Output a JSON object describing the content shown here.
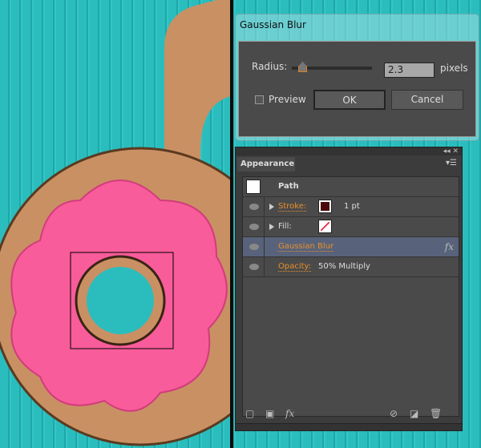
{
  "dialog": {
    "title": "Gaussian Blur",
    "radius_label": "Radius:",
    "radius_value": "2.3",
    "unit": "pixels",
    "preview_label": "Preview",
    "preview_checked": false,
    "ok_label": "OK",
    "cancel_label": "Cancel"
  },
  "panel": {
    "tab": "Appearance",
    "object": "Path",
    "rows": [
      {
        "label": "Stroke:",
        "value": "1 pt",
        "swatch": "#4a0808"
      },
      {
        "label": "Fill:",
        "swatch": "none"
      },
      {
        "label": "Gaussian Blur",
        "badge": "fx"
      },
      {
        "label": "Opacity:",
        "value": "50% Multiply"
      }
    ],
    "footer_fx": "fx"
  },
  "colors": {
    "background": "#2bbdbd",
    "accent": "#e8902a",
    "donut_icing": "#f85c9a",
    "cookie": "#c99064"
  }
}
